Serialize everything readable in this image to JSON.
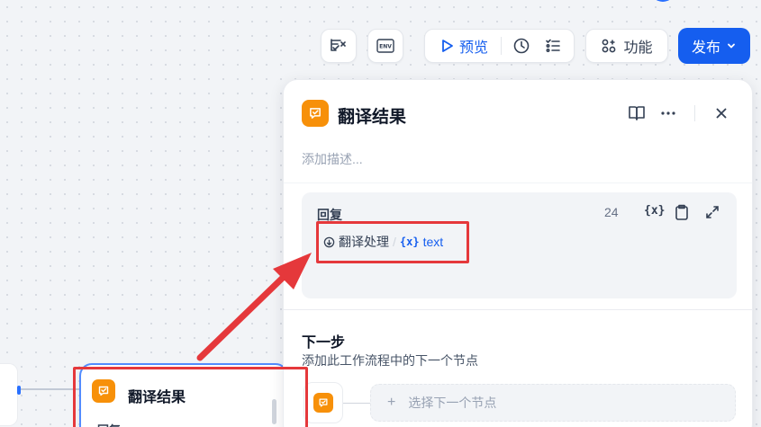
{
  "toolbar": {
    "preview_label": "预览",
    "features_label": "功能",
    "publish_label": "发布"
  },
  "panel": {
    "title": "翻译结果",
    "description_placeholder": "添加描述...",
    "reply": {
      "label": "回复",
      "char_count": "24",
      "source_node": "翻译处理",
      "separator": "/",
      "variable_name": "text"
    },
    "next_step": {
      "heading": "下一步",
      "description": "添加此工作流程中的下一个节点",
      "select_label": "选择下一个节点"
    }
  },
  "canvas": {
    "node_title": "翻译结果",
    "node_subtitle": "回复"
  },
  "colors": {
    "accent": "#155eef",
    "node_orange": "#f79009",
    "annotation_red": "#e5383b"
  }
}
